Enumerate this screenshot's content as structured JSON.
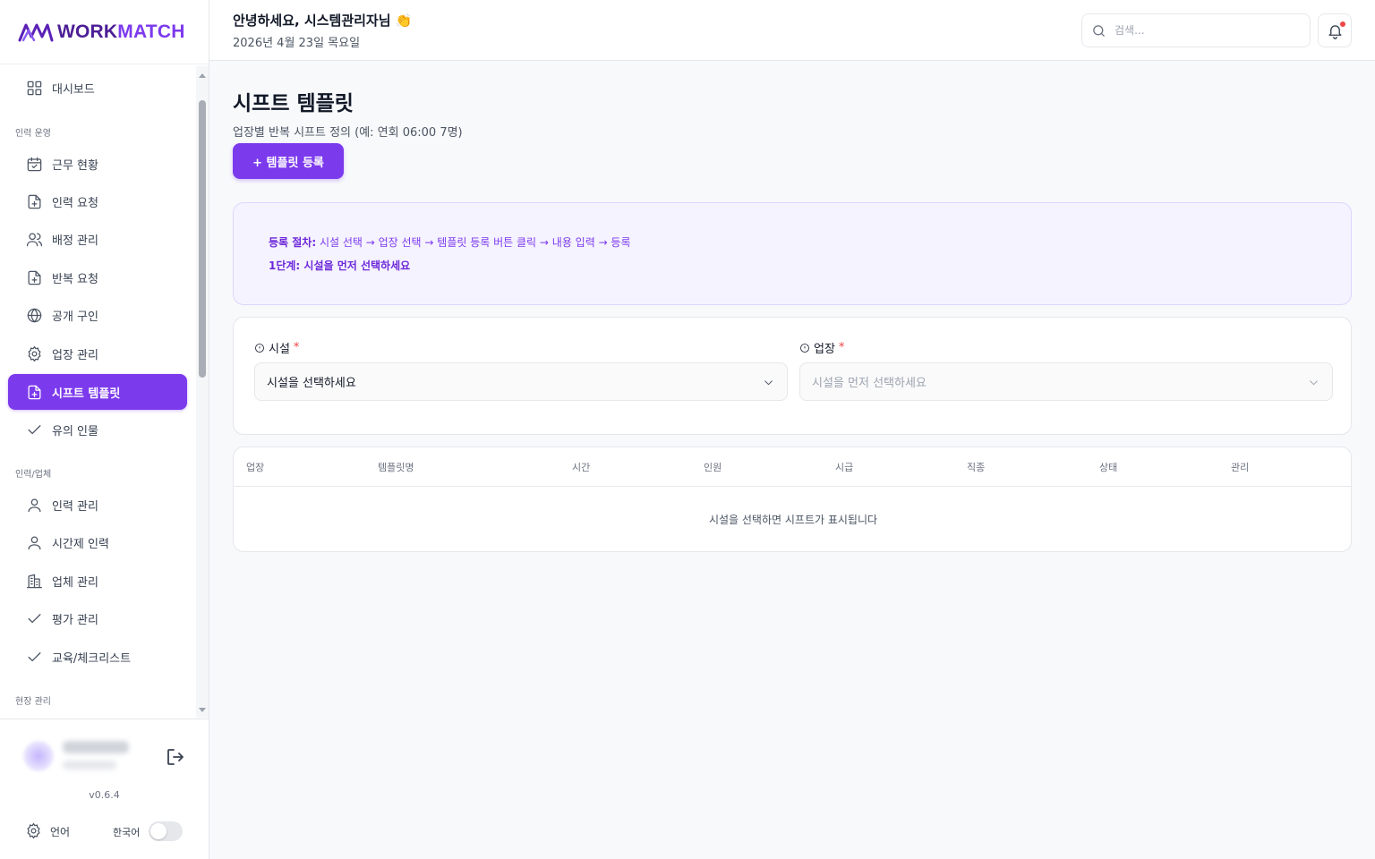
{
  "app": {
    "logo_word1": "WORK",
    "logo_word2": "MATCH",
    "brand_color": "#7c3aed"
  },
  "header": {
    "greeting": "안녕하세요, 시스템관리자님 👏",
    "date": "2026년 4월 23일 목요일",
    "search_placeholder": "검색..."
  },
  "sidebar": {
    "dashboard": "대시보드",
    "section_ops": "인력 운영",
    "ops_items": [
      "근무 현황",
      "인력 요청",
      "배정 관리",
      "반복 요청",
      "공개 구인",
      "업장 관리",
      "시프트 템플릿",
      "유의 인물"
    ],
    "section_workers": "인력/업체",
    "worker_items": [
      "인력 관리",
      "시간제 인력",
      "업체 관리",
      "평가 관리",
      "교육/체크리스트"
    ],
    "section_site": "현장 관리",
    "version": "v0.6.4",
    "language_label": "언어",
    "language_value": "한국어"
  },
  "main": {
    "title": "시프트 템플릿",
    "subtitle": "업장별 반복 시프트 정의 (예: 연회 06:00 7명)",
    "add_button": "+ 템플릿 등록",
    "info": {
      "procedure_label": "등록 절차:",
      "procedure_text": "시설 선택 → 업장 선택 → 템플릿 등록 버튼 클릭 → 내용 입력 → 등록",
      "step": "1단계: 시설을 먼저 선택하세요"
    },
    "facility": {
      "label": "시설",
      "required": "*",
      "placeholder": "시설을 선택하세요"
    },
    "venue": {
      "label": "업장",
      "required": "*",
      "placeholder": "시설을 먼저 선택하세요"
    },
    "table": {
      "columns": [
        "업장",
        "템플릿명",
        "시간",
        "인원",
        "시급",
        "직종",
        "상태",
        "관리"
      ],
      "empty": "시설을 선택하면 시프트가 표시됩니다"
    }
  }
}
